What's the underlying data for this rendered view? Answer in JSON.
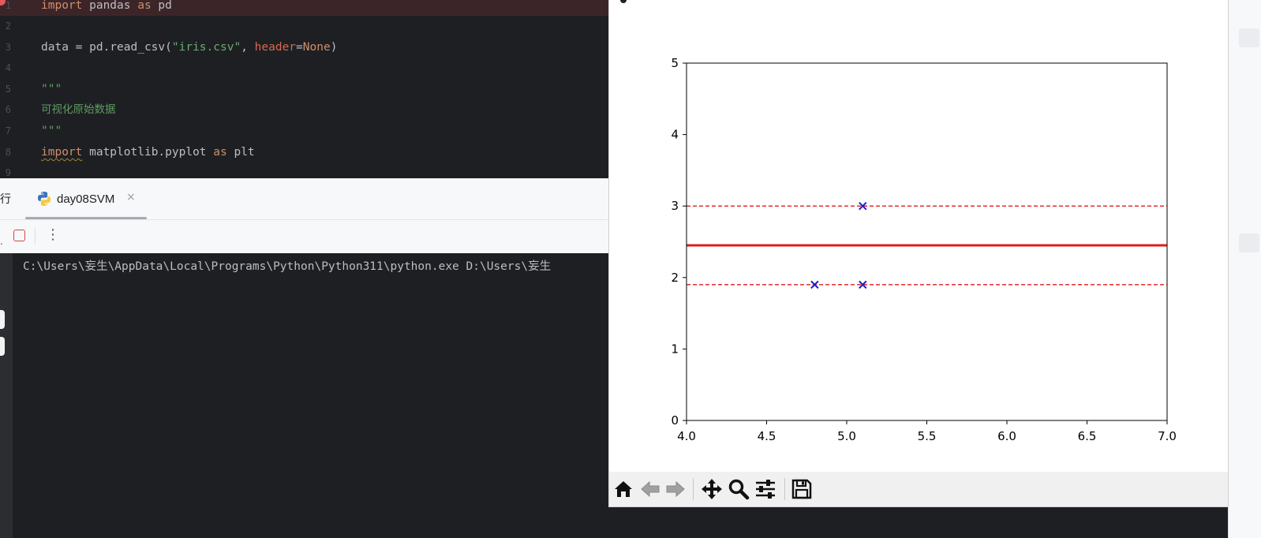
{
  "editor": {
    "lines": [
      {
        "num": "1",
        "tokens": [
          {
            "t": "import",
            "c": "kw"
          },
          {
            "t": " pandas ",
            "c": ""
          },
          {
            "t": "as",
            "c": "kw"
          },
          {
            "t": " pd",
            "c": ""
          }
        ]
      },
      {
        "num": "2",
        "tokens": []
      },
      {
        "num": "3",
        "tokens": [
          {
            "t": "data = pd.read_csv(",
            "c": ""
          },
          {
            "t": "\"iris.csv\"",
            "c": "str"
          },
          {
            "t": ", ",
            "c": ""
          },
          {
            "t": "header",
            "c": "param"
          },
          {
            "t": "=",
            "c": ""
          },
          {
            "t": "None",
            "c": "kw"
          },
          {
            "t": ")",
            "c": ""
          }
        ]
      },
      {
        "num": "4",
        "tokens": []
      },
      {
        "num": "5",
        "tokens": [
          {
            "t": "\"\"\"",
            "c": "doc"
          }
        ]
      },
      {
        "num": "6",
        "tokens": [
          {
            "t": "可视化原始数据",
            "c": "doc cjk"
          }
        ]
      },
      {
        "num": "7",
        "tokens": [
          {
            "t": "\"\"\"",
            "c": "doc"
          }
        ]
      },
      {
        "num": "8",
        "tokens": [
          {
            "t": "import",
            "c": "kw squig"
          },
          {
            "t": " matplotlib.pyplot ",
            "c": ""
          },
          {
            "t": "as",
            "c": "kw"
          },
          {
            "t": " plt",
            "c": ""
          }
        ]
      },
      {
        "num": "9",
        "tokens": []
      }
    ]
  },
  "run_panel": {
    "title": "行",
    "tab_label": "day08SVM",
    "tab_close": "×",
    "more": "⋮",
    "console_line": "C:\\Users\\妄生\\AppData\\Local\\Programs\\Python\\Python311\\python.exe D:\\Users\\妄生"
  },
  "chart_data": {
    "type": "scatter",
    "xlim": [
      4.0,
      7.0
    ],
    "ylim": [
      0,
      5
    ],
    "x_ticks": [
      "4.0",
      "4.5",
      "5.0",
      "5.5",
      "6.0",
      "6.5",
      "7.0"
    ],
    "y_ticks": [
      "0",
      "1",
      "2",
      "3",
      "4",
      "5"
    ],
    "points": [
      {
        "x": 5.1,
        "y": 3.0
      },
      {
        "x": 4.8,
        "y": 1.9
      },
      {
        "x": 5.1,
        "y": 1.9
      }
    ],
    "marker": "x",
    "marker_color": "#1f1fcf",
    "lines": [
      {
        "y": 2.45,
        "style": "solid",
        "color": "#e01b1b"
      },
      {
        "y": 3.0,
        "style": "dashed",
        "color": "#e01b1b"
      },
      {
        "y": 1.9,
        "style": "dashed",
        "color": "#e01b1b"
      }
    ],
    "grid": false
  },
  "mpl_toolbar": {
    "buttons": [
      "home-icon",
      "back-arrow-icon",
      "forward-arrow-icon",
      "pan-icon",
      "zoom-icon",
      "configure-subplots-icon",
      "save-icon"
    ]
  }
}
